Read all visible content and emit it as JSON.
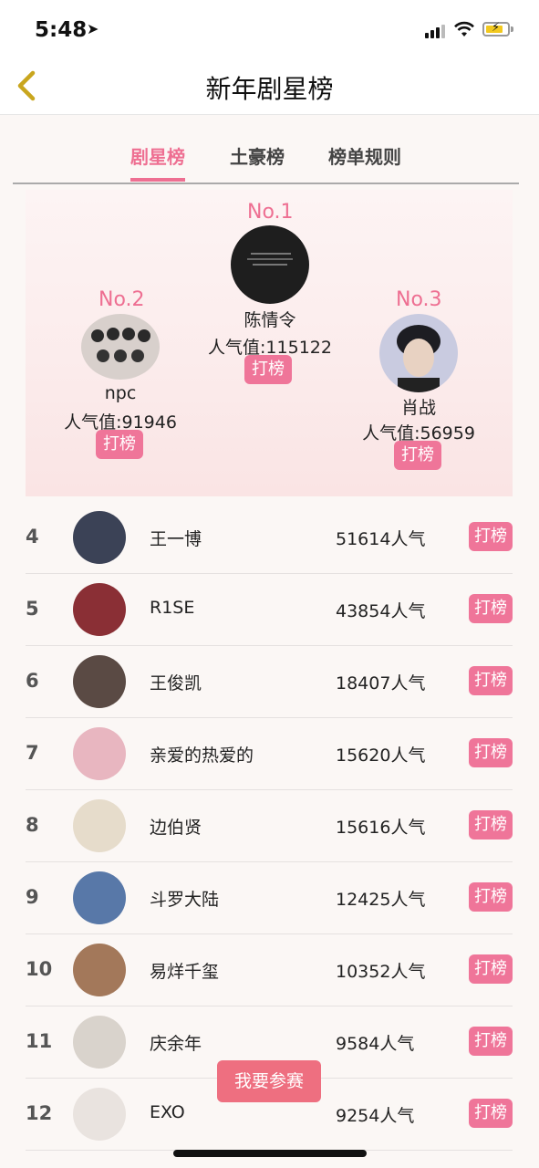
{
  "status": {
    "time": "5:48"
  },
  "nav": {
    "title": "新年剧星榜"
  },
  "tabs": [
    {
      "label": "剧星榜"
    },
    {
      "label": "土豪榜"
    },
    {
      "label": "榜单规则"
    }
  ],
  "podium": [
    {
      "rank": "No.1",
      "name": "陈情令",
      "score": "人气值:115122",
      "button": "打榜",
      "avatar_color": "#1e1e1e"
    },
    {
      "rank": "No.2",
      "name": "npc",
      "score": "人气值:91946",
      "button": "打榜",
      "avatar_color": "#d8d0cc"
    },
    {
      "rank": "No.3",
      "name": "肖战",
      "score": "人气值:56959",
      "button": "打榜",
      "avatar_color": "#c9cbe0"
    }
  ],
  "list": [
    {
      "rank": "4",
      "name": "王一博",
      "score": "51614人气",
      "button": "打榜",
      "avatar_color": "#3b4256"
    },
    {
      "rank": "5",
      "name": "R1SE",
      "score": "43854人气",
      "button": "打榜",
      "avatar_color": "#8a2f35"
    },
    {
      "rank": "6",
      "name": "王俊凯",
      "score": "18407人气",
      "button": "打榜",
      "avatar_color": "#5a4a44"
    },
    {
      "rank": "7",
      "name": "亲爱的热爱的",
      "score": "15620人气",
      "button": "打榜",
      "avatar_color": "#e8b6c0"
    },
    {
      "rank": "8",
      "name": "边伯贤",
      "score": "15616人气",
      "button": "打榜",
      "avatar_color": "#e6dccb"
    },
    {
      "rank": "9",
      "name": "斗罗大陆",
      "score": "12425人气",
      "button": "打榜",
      "avatar_color": "#5878a8"
    },
    {
      "rank": "10",
      "name": "易烊千玺",
      "score": "10352人气",
      "button": "打榜",
      "avatar_color": "#a3785a"
    },
    {
      "rank": "11",
      "name": "庆余年",
      "score": "9584人气",
      "button": "打榜",
      "avatar_color": "#d9d3cc"
    },
    {
      "rank": "12",
      "name": "EXO",
      "score": "9254人气",
      "button": "打榜",
      "avatar_color": "#e9e3df"
    }
  ],
  "join_button": "我要参赛"
}
